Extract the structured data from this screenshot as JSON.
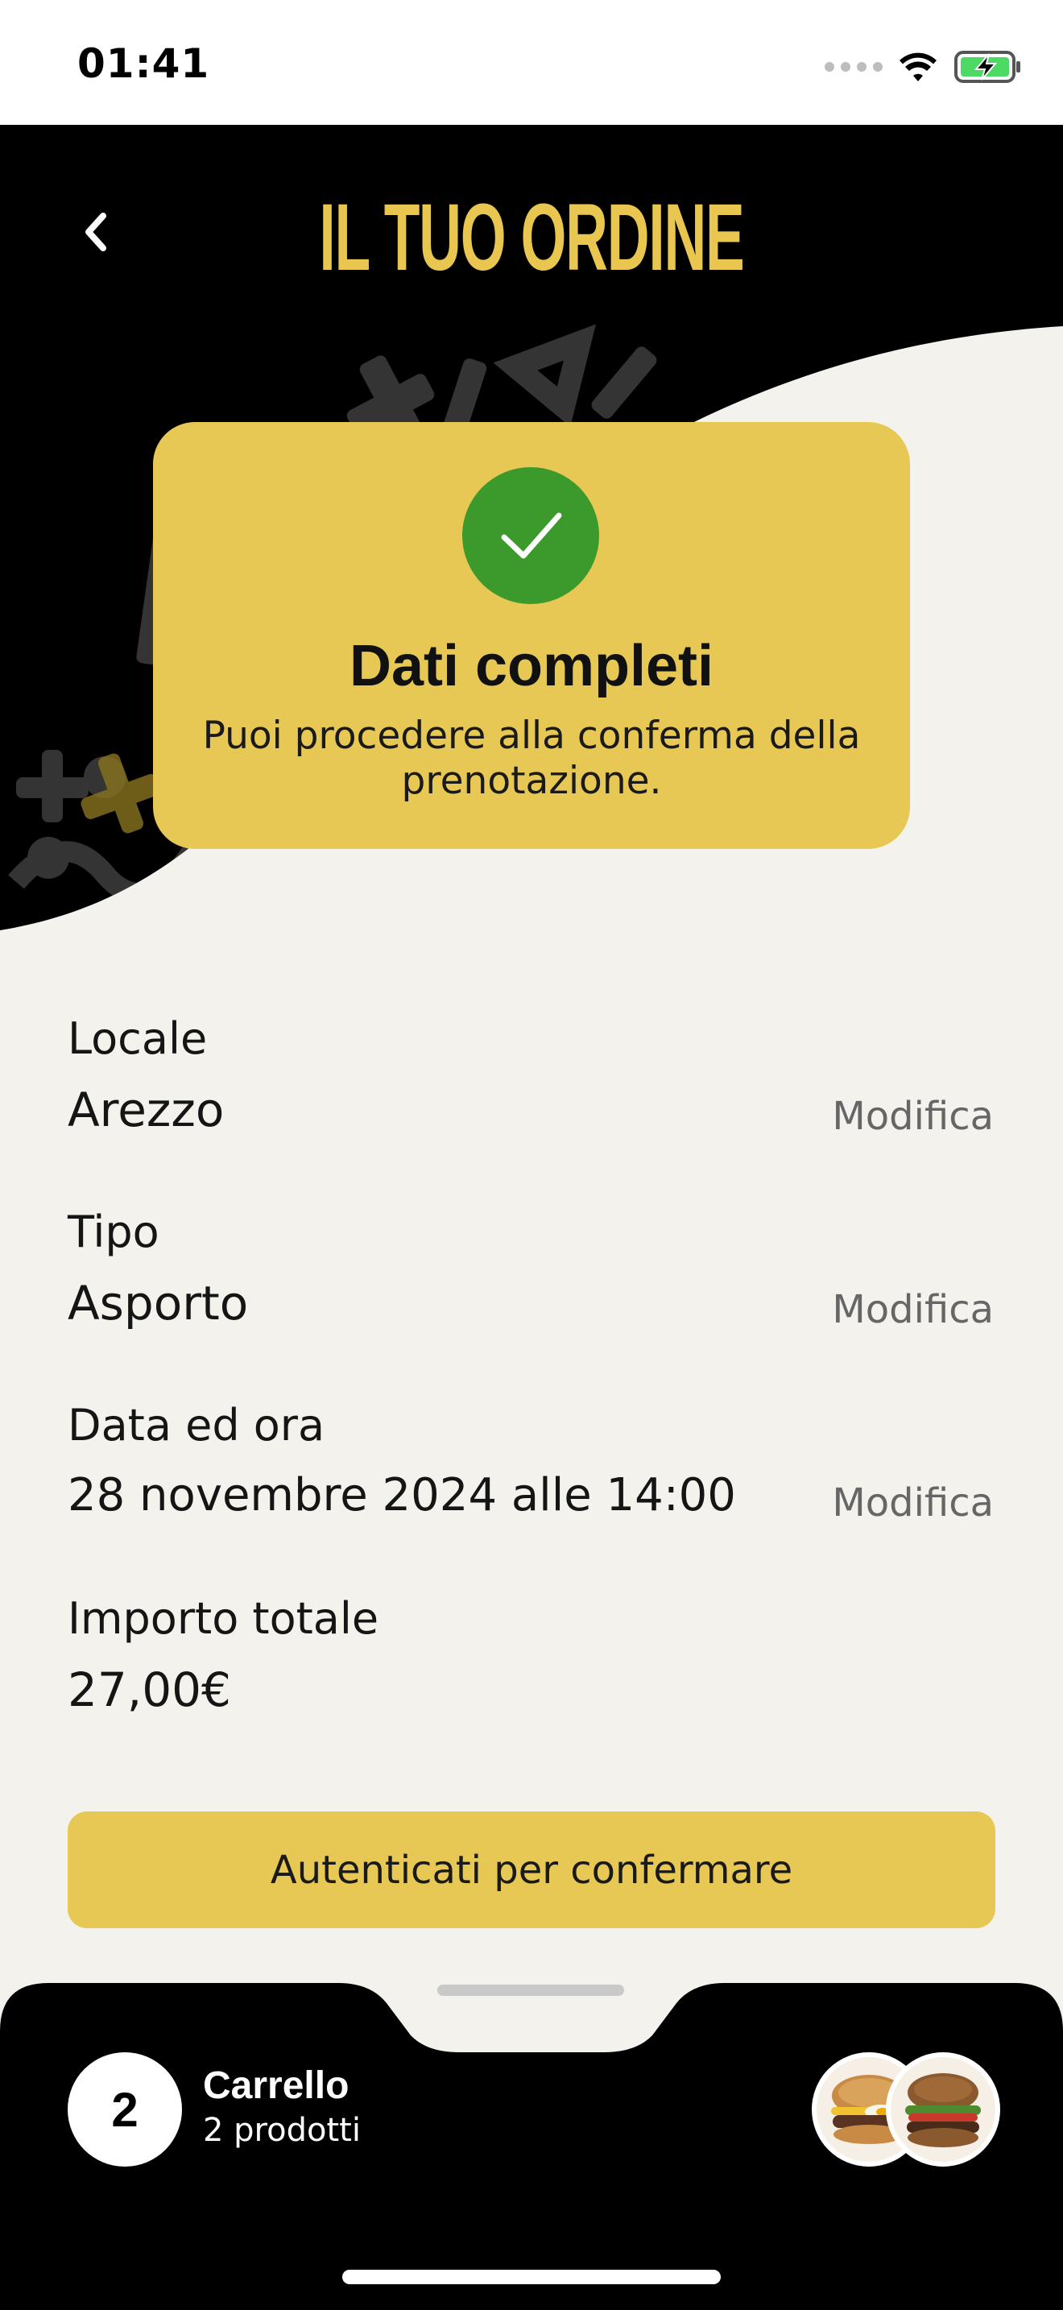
{
  "status_bar": {
    "time": "01:41",
    "icons": [
      "signal-dots",
      "wifi-icon",
      "battery-charging-icon"
    ]
  },
  "header": {
    "title": "IL TUO ORDINE",
    "back_icon": "chevron-left-icon",
    "accent_color": "#E9C650"
  },
  "completion_card": {
    "icon": "check-icon",
    "title": "Dati completi",
    "subtitle": "Puoi procedere alla conferma della prenotazione.",
    "background": "#E8C854",
    "check_color": "#3C9A2C"
  },
  "details": [
    {
      "label": "Locale",
      "value": "Arezzo",
      "action": "Modifica"
    },
    {
      "label": "Tipo",
      "value": "Asporto",
      "action": "Modifica"
    },
    {
      "label": "Data ed ora",
      "value": "28 novembre 2024 alle 14:00",
      "action": "Modifica"
    },
    {
      "label": "Importo totale",
      "value": "27,00€"
    }
  ],
  "confirm_button": {
    "label": "Autenticati per confermare"
  },
  "cart": {
    "count": "2",
    "title": "Carrello",
    "subtitle": "2 prodotti",
    "thumbnails": [
      "burger-egg-image",
      "burger-salad-image"
    ]
  }
}
